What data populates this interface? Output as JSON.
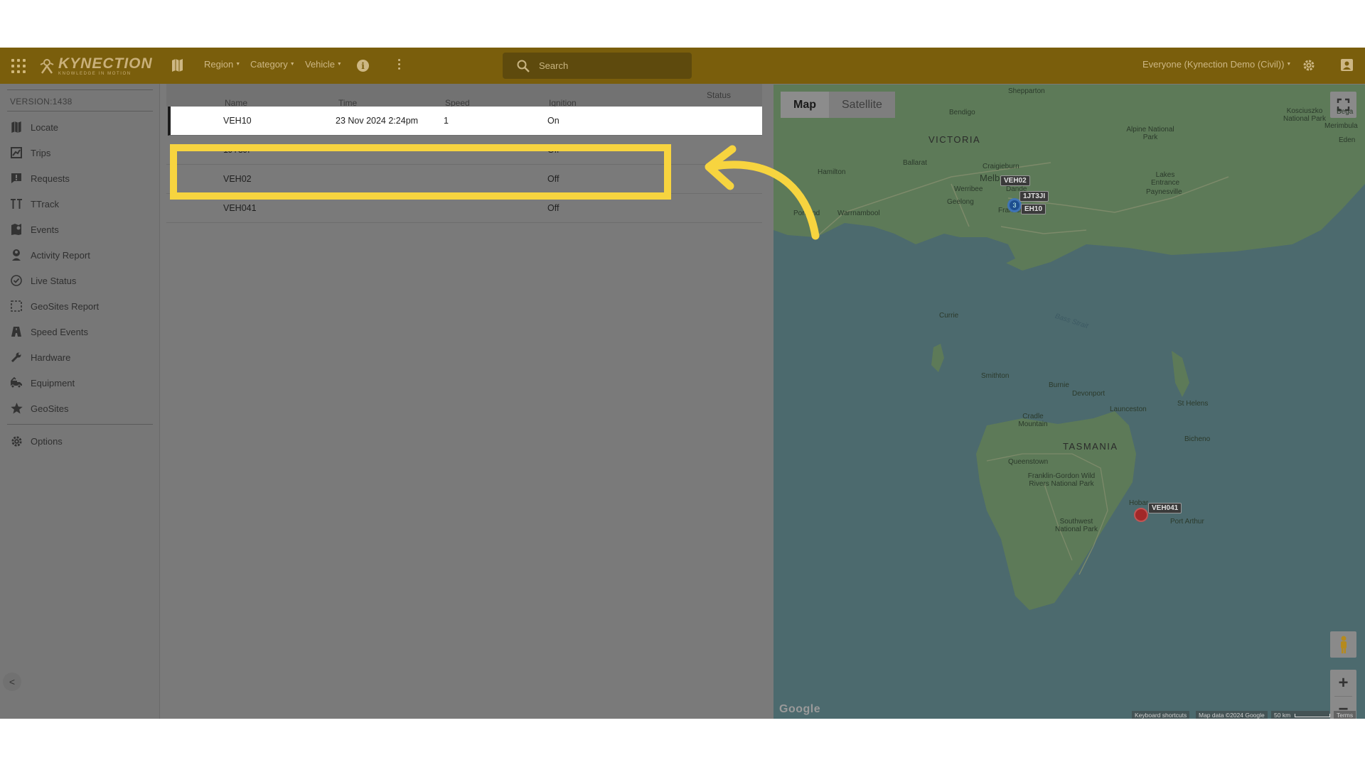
{
  "topbar": {
    "logo_main": "KYNECTION",
    "logo_sub": "KNOWLEDGE IN MOTION",
    "region_label": "Region",
    "category_label": "Category",
    "vehicle_label": "Vehicle",
    "search_placeholder": "Search",
    "account_label": "Everyone (Kynection Demo (Civil))",
    "accent_color": "#7a5e0c"
  },
  "sidebar": {
    "version": "VERSION:1438",
    "items": [
      {
        "label": "Locate",
        "icon": "map-icon"
      },
      {
        "label": "Trips",
        "icon": "trips-icon"
      },
      {
        "label": "Requests",
        "icon": "requests-icon"
      },
      {
        "label": "TTrack",
        "icon": "ttrack-icon"
      },
      {
        "label": "Events",
        "icon": "events-icon"
      },
      {
        "label": "Activity Report",
        "icon": "person-pin-icon"
      },
      {
        "label": "Live Status",
        "icon": "check-circle-icon"
      },
      {
        "label": "GeoSites Report",
        "icon": "dashed-square-icon"
      },
      {
        "label": "Speed Events",
        "icon": "road-icon"
      },
      {
        "label": "Hardware",
        "icon": "wrench-icon"
      },
      {
        "label": "Equipment",
        "icon": "truck-icon"
      },
      {
        "label": "GeoSites",
        "icon": "star-icon"
      }
    ],
    "options_label": "Options"
  },
  "table": {
    "headers": {
      "name": "Name",
      "time": "Time",
      "speed": "Speed",
      "ignition": "Ignition",
      "status": "Status"
    },
    "rows": [
      {
        "name": "VEH10",
        "time": "23 Nov 2024 2:24pm",
        "speed": "1",
        "ignition": "On",
        "selected": true
      },
      {
        "name": "1JT3JI",
        "time": "",
        "speed": "",
        "ignition": "Off",
        "selected": false
      },
      {
        "name": "VEH02",
        "time": "",
        "speed": "",
        "ignition": "Off",
        "selected": false
      },
      {
        "name": "VEH041",
        "time": "",
        "speed": "",
        "ignition": "Off",
        "selected": false
      }
    ]
  },
  "map": {
    "map_tab": "Map",
    "satellite_tab": "Satellite",
    "places": {
      "victoria": "VICTORIA",
      "tasmania": "TASMANIA",
      "shepparton": "Shepparton",
      "bendigo": "Bendigo",
      "kosciuszko": "Kosciuszko National Park",
      "alpine": "Alpine National Park",
      "bega": "Bega",
      "merimbula": "Merimbula",
      "eden": "Eden",
      "ballarat": "Ballarat",
      "craigieburn": "Craigieburn",
      "melbourne": "Melb",
      "werribee": "Werribee",
      "dandenong": "Dande",
      "geelong": "Geelong",
      "frankston": "Frankston",
      "hamilton": "Hamilton",
      "portland": "Portland",
      "warrnambool": "Warrnambool",
      "lakes_entrance": "Lakes Entrance",
      "paynesville": "Paynesville",
      "currie": "Currie",
      "bass_strait": "Bass Strait",
      "smithton": "Smithton",
      "burnie": "Burnie",
      "devonport": "Devonport",
      "launceston": "Launceston",
      "st_helens": "St Helens",
      "cradle": "Cradle Mountain",
      "bicheno": "Bicheno",
      "queenstown": "Queenstown",
      "franklin": "Franklin-Gordon Wild Rivers National Park",
      "hobart": "Hobar",
      "port_arthur": "Port Arthur",
      "southwest": "Southwest National Park"
    },
    "markers": {
      "veh02": "VEH02",
      "jt3ji": "1JT3JI",
      "veh10": "EH10",
      "cluster_count": "3",
      "veh041": "VEH041"
    },
    "google_logo": "Google",
    "attribution": {
      "shortcuts": "Keyboard shortcuts",
      "data": "Map data ©2024 Google",
      "scale": "50 km",
      "terms": "Terms"
    }
  },
  "annotation": {
    "highlight_color": "#f7d43f"
  }
}
